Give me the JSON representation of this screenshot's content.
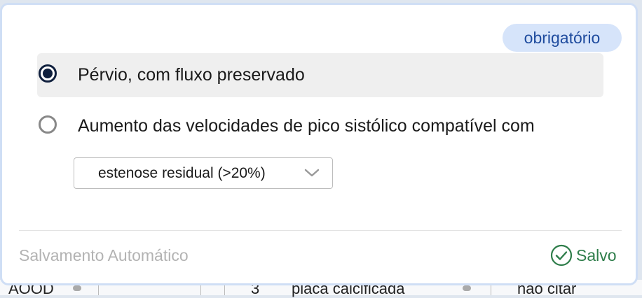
{
  "badge": {
    "label": "obrigatório"
  },
  "options": [
    {
      "label": "Pérvio, com fluxo preservado",
      "selected": true
    },
    {
      "label": "Aumento das velocidades de pico sistólico compatível com",
      "selected": false
    }
  ],
  "stenosis_select": {
    "value": "estenose residual (>20%)"
  },
  "footer": {
    "autosave_label": "Salvamento Automático",
    "saved_label": "Salvo"
  },
  "background_table": {
    "cells": [
      "AOOD",
      "3",
      "placa calcificada",
      "não citar"
    ]
  },
  "colors": {
    "badge_bg": "#d6e4fa",
    "badge_text": "#1e4b9e",
    "radio_selected": "#0f1f3d",
    "saved_green": "#2e7d4a",
    "card_border": "#cfdef5"
  },
  "icons": {
    "saved": "check-circle-icon",
    "select": "chevron-down-icon"
  }
}
